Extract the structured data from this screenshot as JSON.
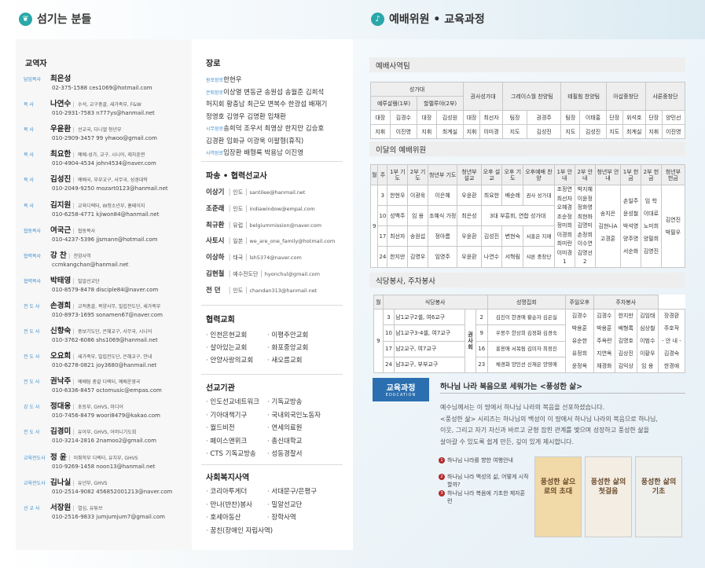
{
  "left_header": {
    "title": "섬기는 분들",
    "icon": "leaf-icon"
  },
  "right_header": {
    "title": "예배위원 • 교육과정",
    "icon": "bell-icon"
  },
  "teachers": {
    "title": "교역자",
    "items": [
      {
        "role": "담임목사",
        "name": "최은성",
        "desc": "",
        "contact": "02-375-1588  ces1069@hotmail.com"
      },
      {
        "role": "목   사",
        "name": "나연수",
        "desc": "수석, 교구총괄, 새가족부, F&W",
        "contact": "010-2931-7583  n777ys@hanmail.net"
      },
      {
        "role": "목   사",
        "name": "우윤환",
        "desc": "선교국, 다니엘 청년부",
        "contact": "010-2909-3457 99  yhwoo@gmail.com"
      },
      {
        "role": "목   사",
        "name": "최요한",
        "desc": "예배-성가, 교구, 시니어, 제자훈련",
        "contact": "010-4904-4534  john4534@naver.com"
      },
      {
        "role": "목   사",
        "name": "김성진",
        "desc": "예배국, 부부교구, 사무국, 성경대학",
        "contact": "010-2049-9250  mozart0123@hanmail.net"
      },
      {
        "role": "목   사",
        "name": "김지원",
        "desc": "교육디렉터, W청소년부, 홈페이지",
        "contact": "010-6258-4771  kjiwon84@hanmail.net"
      },
      {
        "role": "협동목사",
        "name": "여국근",
        "desc": "협동목사",
        "contact": "010-4237-5396  jjsmann@hotmail.com"
      },
      {
        "role": "협력목사",
        "name": "강  찬",
        "desc": "찬양사역",
        "contact": "ccmkangchan@hanmail.net"
      },
      {
        "role": "협력목사",
        "name": "박태영",
        "desc": "밀알선교단",
        "contact": "010-8579-8478  disciple84@naver.com"
      },
      {
        "role": "전 도 사",
        "name": "손경희",
        "desc": "교적총괄, 목양사무, 빌립전도단, 새가족부",
        "contact": "010-8973-1695  sonamen67@naver.com"
      },
      {
        "role": "전 도 사",
        "name": "신향숙",
        "desc": "중보기도단, 은혜교구, 사무국, 시니어",
        "contact": "010-3762-6086  shs1069@hanmail.net"
      },
      {
        "role": "전 도 사",
        "name": "오요희",
        "desc": "새가족부, 빌립전도단, 은혜교구, 안내",
        "contact": "010-6278-0821  joy3680@hanmail.net"
      },
      {
        "role": "전 도 사",
        "name": "권낙주",
        "desc": "예배팀 총괄 디렉터, 예배운영국",
        "contact": "010-6336-8457  octomusic@empas.com"
      },
      {
        "role": "강 도 사",
        "name": "정대웅",
        "desc": "초등부, GHVS, 미디어",
        "contact": "010-7456-8479  woori8479@kakao.com"
      },
      {
        "role": "전 도 사",
        "name": "김경미",
        "desc": "유아부, GHVS, 어머니기도회",
        "contact": "010-3214-2816  2namoo2@gmail.com"
      },
      {
        "role": "교육전도사",
        "name": "정  윤",
        "desc": "미취학부 디렉터, 유치부, GHVS",
        "contact": "010-9269-1458  noon13@hanmail.net"
      },
      {
        "role": "교육전도사",
        "name": "김나실",
        "desc": "유년부, GHVS",
        "contact": "010-2514-9082  456852001213@naver.com"
      },
      {
        "role": "선 교 사",
        "name": "서장원",
        "desc": "열심, 유튜브",
        "contact": "010-2516-9833  jumjumjum7@gmail.com"
      }
    ]
  },
  "elders": {
    "title": "장로",
    "lines": [
      {
        "label": "원로장로",
        "names": "한현우"
      },
      {
        "label": "은퇴장로",
        "names": "이상열 변동균 송원섭 송월준 김희석"
      },
      {
        "label": "",
        "names": "허지회 황충남 최근모 변복수 한광섭 배재기"
      },
      {
        "label": "",
        "names": "정영호 김영우 김명환 임채환"
      },
      {
        "label": "시무장로",
        "names": "송희덕 조우서 최영상 한지만 김승호"
      },
      {
        "label": "",
        "names": "김경환 임화규 이광욱 이팔형(휴직)"
      },
      {
        "label": "사역장로",
        "names": "임장환 배형록 박용남 이진영"
      }
    ]
  },
  "missionaries": {
    "title": "파송 • 협력선교사",
    "items": [
      {
        "name": "이상기",
        "place": "인도",
        "email": "santilee@hanmail.net"
      },
      {
        "name": "조준래",
        "place": "인도",
        "email": "indiawindow@empal.com"
      },
      {
        "name": "최규환",
        "place": "유럽",
        "email": "belgiummission@naver.com"
      },
      {
        "name": "사토시",
        "place": "일본",
        "email": "we_are_one_family@hotmail.com"
      },
      {
        "name": "이상하",
        "place": "태국",
        "email": "lsh5374@naver.com"
      },
      {
        "name": "김현철",
        "place": "예수전도단",
        "email": "hyonchul@gmail.com"
      },
      {
        "name": "전  던",
        "place": "인도",
        "email": "chandan313@hanmail.net"
      }
    ]
  },
  "partner_churches": {
    "title": "협력교회",
    "items": [
      "인천은현교회",
      "이평주안교회",
      "살아있는교회",
      "화포중앙교회",
      "안양사랑의교회",
      "새오름교회"
    ]
  },
  "missions_orgs": {
    "title": "선교기관",
    "items": [
      "인도선교네트워크",
      "기독교방송",
      "기아대책기구",
      "국내외국인노동자",
      "월드비전",
      "연세의료원",
      "페이스앤위크",
      "총신대학교",
      "CTS 기독교방송",
      "성동경찰서"
    ]
  },
  "welfare": {
    "title": "사회복지사역",
    "items": [
      "코리아투게더",
      "서대문구/은평구",
      "만나(반찬)봉사",
      "밀알선교단",
      "호세아동산",
      "장학사역",
      "꿈친(장애인 자립사역)"
    ]
  },
  "worship_team": {
    "title": "예배사역팀",
    "head1": [
      "성가대",
      "권사성가대",
      "그레이스월 찬양팀",
      "테필힘 찬양팀",
      "아삽중창단",
      "샤론중창단"
    ],
    "head2": [
      "예루살렘(1부)",
      "할렐루야(2부)"
    ],
    "rows": [
      [
        "대장",
        "김경수",
        "대장",
        "김성원",
        "대장",
        "최선자",
        "팀장",
        "권경주",
        "팀장",
        "이태홍",
        "단장",
        "위석호",
        "단장",
        "양민선"
      ],
      [
        "지휘",
        "이진영",
        "지휘",
        "최계실",
        "지휘",
        "이미경",
        "지도",
        "김성진",
        "지도",
        "김성진",
        "지도",
        "최계실",
        "지휘",
        "이진영"
      ]
    ]
  },
  "monthly": {
    "title": "이달의 예배위원",
    "headers": [
      "월",
      "주",
      "1부 기도",
      "2부 기도",
      "청년부 기도",
      "청년부 설교",
      "오후 설교",
      "오후 기도",
      "오후예배 찬양",
      "1부 안내",
      "2부 안내",
      "청년부 안내",
      "1부 헌금",
      "2부 헌금",
      "청년부 헌금"
    ],
    "month": "9",
    "rows": [
      {
        "w": "3",
        "c": [
          "한현우",
          "이광욱",
          "이은혜",
          "우윤환",
          "최요한",
          "배순례",
          "권사 성가대"
        ]
      },
      {
        "w": "10",
        "c": [
          "성백주",
          "임 용",
          "조혜식 가정",
          "최은성",
          "3대 부흥회, 연합 성가대"
        ]
      },
      {
        "w": "17",
        "c": [
          "최선자",
          "송원섭",
          "정아름",
          "우윤환",
          "김성진",
          "변현숙",
          "서홍은 지매"
        ]
      },
      {
        "w": "24",
        "c": [
          "한지만",
          "김영우",
          "임영주",
          "우윤환",
          "나연수",
          "서혁림",
          "샤론 중창단"
        ]
      }
    ],
    "ushers1": "조정연 최선자 오혜경 조순정 정미희 이경희 최미란 이미경1",
    "ushers2": "박지혜 이윤정 정화영 최현화 김명미 손정희 이수연 김명선2",
    "ushers_y": [
      "송지은",
      "김현나A",
      "고경훈"
    ],
    "off1": [
      "손일주",
      "윤성철",
      "박석영",
      "양주영",
      "서순화"
    ],
    "off2": [
      "임  학",
      "이대로",
      "노미희",
      "양필희",
      "김영진"
    ],
    "offy": [
      "김연진",
      "박필우"
    ]
  },
  "dining": {
    "title": "식당봉사, 주차봉사",
    "headers": [
      "월",
      "식당봉사",
      "성명집회",
      "주일오후",
      "주차봉사"
    ],
    "month": "9",
    "rows": [
      {
        "w": "3",
        "a": "남1교구2셀, 여6교구",
        "n": "2",
        "b": "김진이 한경애 황순자 김은실"
      },
      {
        "w": "10",
        "a": "남1교구3-4셀, 여7교구",
        "n": "9",
        "b": "우봉주 한상희 김정화 김경숙"
      },
      {
        "w": "17",
        "a": "남2교구, 여7교구",
        "n": "16",
        "b": "홍용애 서복림 김미자 최정진"
      },
      {
        "w": "24",
        "a": "남3교구, 부부교구",
        "n": "23",
        "b": "채경화 양민선 신재은 양영애"
      }
    ],
    "mid_label": "권 사 회",
    "col_a": [
      "김경수",
      "박용훈",
      "유순한",
      "유정희",
      "윤정옥"
    ],
    "col_b": [
      "김경수",
      "박용훈",
      "주옥련",
      "지연옥",
      "채경화"
    ],
    "park1": [
      "한지만",
      "배형록",
      "김명호",
      "김상진",
      "김익상"
    ],
    "park2": [
      "김임태",
      "심상철",
      "이범수",
      "이황우",
      "임  용"
    ],
    "park3": [
      "장경환",
      "주호작",
      "- 안 내 -",
      "김경숙",
      "한경애"
    ]
  },
  "education": {
    "badge": "교육과정",
    "badge_sub": "EDUCATION",
    "headline": "하나님 나라 복음으로 세워가는 <풍성한 삶>",
    "para1": "예수님께서는 이 땅에서 하나님 나라의 복음을 선포하셨습니다.",
    "para2": "<풍성한 삶> 시리즈는 하나님의 백성이 이 땅에서 하나님 나라의 복음으로 하나님,",
    "para3": "이웃, 그리고 자기 자신과 바르고 균형 잡힌 관계를 맺으며 성장하고 풍성한 삶을",
    "para4": "살아갈 수 있도록 쉽게 만든, 깊이 있게 제시합니다.",
    "steps": [
      {
        "no": "1",
        "text": "하나님 나라를 향한 여행안내"
      },
      {
        "no": "2",
        "text": "하나님 나라 백성의 삶, 어떻게 시작할까?"
      },
      {
        "no": "3",
        "text": "하나님 나라 복음에 기초한 제자훈련"
      }
    ],
    "books": [
      {
        "title": "풍성한 삶으로의 초대",
        "bg": "#f1d9a8"
      },
      {
        "title": "풍성한 삶의 첫걸음",
        "bg": "#f3ede3"
      },
      {
        "title": "풍성한 삶의 기초",
        "bg": "#efefec"
      }
    ]
  }
}
